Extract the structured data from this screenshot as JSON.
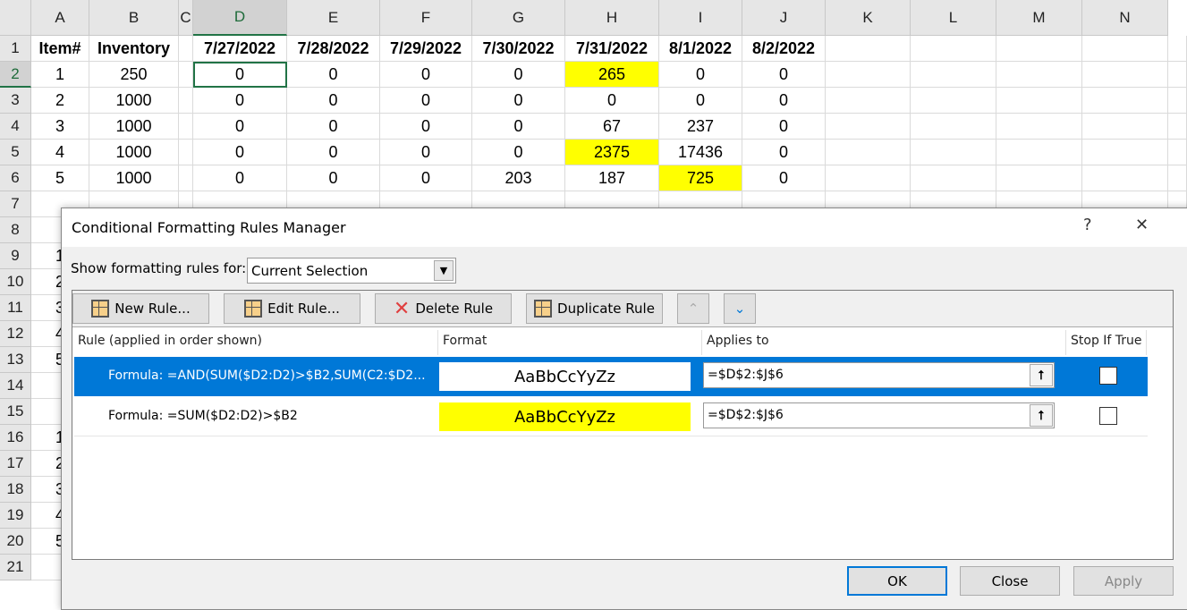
{
  "sheet": {
    "columns": [
      "A",
      "B",
      "C",
      "D",
      "E",
      "F",
      "G",
      "H",
      "I",
      "J",
      "K",
      "L",
      "M",
      "N"
    ],
    "rows": [
      [
        "Item#",
        "Inventory",
        "",
        "7/27/2022",
        "7/28/2022",
        "7/29/2022",
        "7/30/2022",
        "7/31/2022",
        "8/1/2022",
        "8/2/2022"
      ],
      [
        "1",
        "250",
        "",
        "0",
        "0",
        "0",
        "0",
        "265",
        "0",
        "0"
      ],
      [
        "2",
        "1000",
        "",
        "0",
        "0",
        "0",
        "0",
        "0",
        "0",
        "0"
      ],
      [
        "3",
        "1000",
        "",
        "0",
        "0",
        "0",
        "0",
        "67",
        "237",
        "0"
      ],
      [
        "4",
        "1000",
        "",
        "0",
        "0",
        "0",
        "0",
        "2375",
        "17436",
        "0"
      ],
      [
        "5",
        "1000",
        "",
        "0",
        "0",
        "0",
        "203",
        "187",
        "725",
        "0"
      ],
      [],
      [],
      [
        "1"
      ],
      [
        "2"
      ],
      [
        "3"
      ],
      [
        "4"
      ],
      [
        "5"
      ],
      [],
      [],
      [
        "1"
      ],
      [
        "2"
      ],
      [
        "3"
      ],
      [
        "4"
      ],
      [
        "5"
      ],
      []
    ],
    "highlighted_cells": [
      "H2",
      "H5",
      "I6"
    ],
    "active_cell": "D2",
    "highlight_color": "#ffff00"
  },
  "dialog": {
    "title": "Conditional Formatting Rules Manager",
    "help": "?",
    "close": "✕",
    "show_label": "Show formatting rules for:",
    "show_value": "Current Selection",
    "toolbar": {
      "new": "New Rule...",
      "edit": "Edit Rule...",
      "delete": "Delete Rule",
      "duplicate": "Duplicate Rule",
      "up": "⌃",
      "down": "⌄"
    },
    "headers": {
      "rule": "Rule (applied in order shown)",
      "format": "Format",
      "applies": "Applies to",
      "stop": "Stop If True"
    },
    "rules": [
      {
        "rule": "Formula: =AND(SUM($D2:D2)>$B2,SUM(C2:$D2...",
        "format_preview": "AaBbCcYyZz",
        "format_fill": "#ffffff",
        "applies_to": "=$D$2:$J$6",
        "stop_if_true": false,
        "selected": true
      },
      {
        "rule": "Formula: =SUM($D2:D2)>$B2",
        "format_preview": "AaBbCcYyZz",
        "format_fill": "#ffff00",
        "applies_to": "=$D$2:$J$6",
        "stop_if_true": false,
        "selected": false
      }
    ],
    "buttons": {
      "ok": "OK",
      "close": "Close",
      "apply": "Apply"
    },
    "selection_color": "#0078d7"
  }
}
